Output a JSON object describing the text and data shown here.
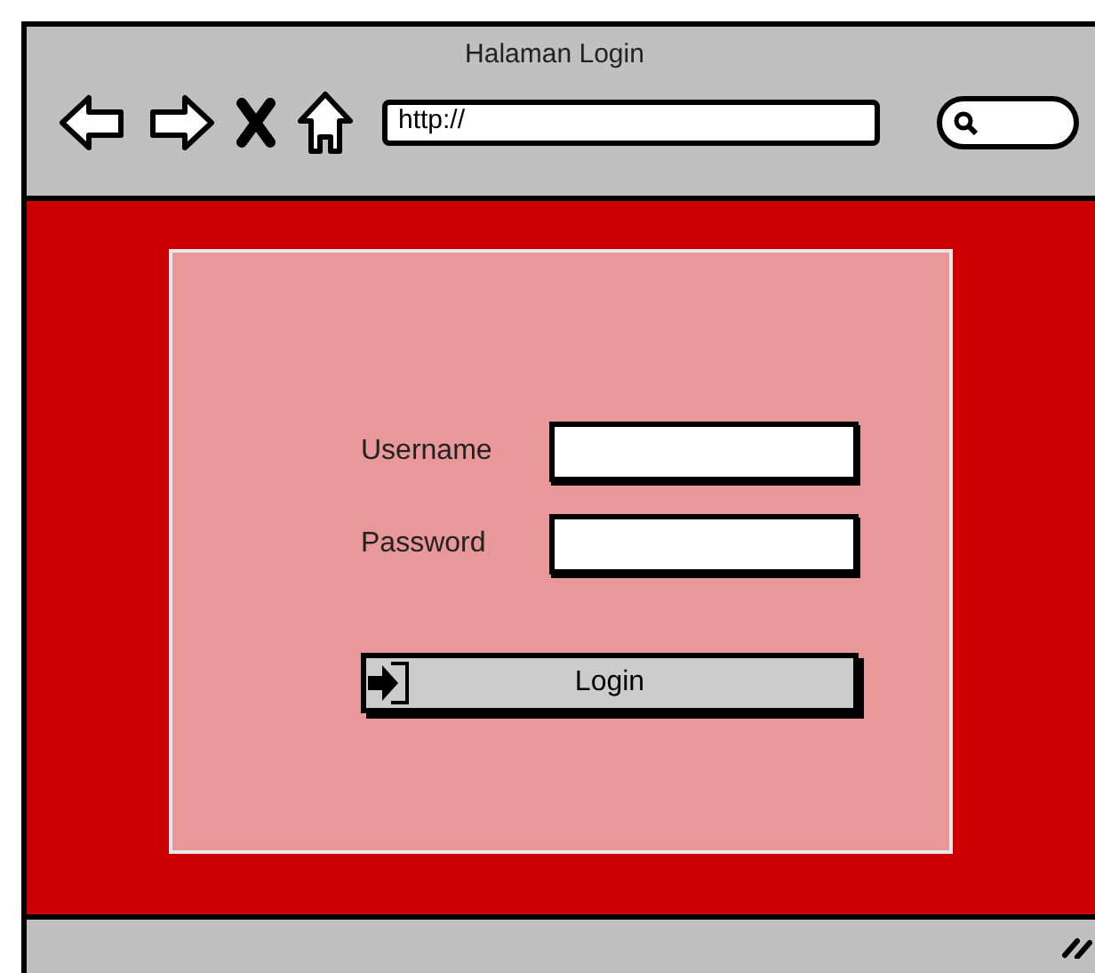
{
  "window": {
    "title": "Halaman Login"
  },
  "address_bar": {
    "value": "http://"
  },
  "form": {
    "fields": [
      {
        "label": "Username"
      },
      {
        "label": "Password"
      }
    ],
    "button": {
      "label": "Login"
    }
  }
}
